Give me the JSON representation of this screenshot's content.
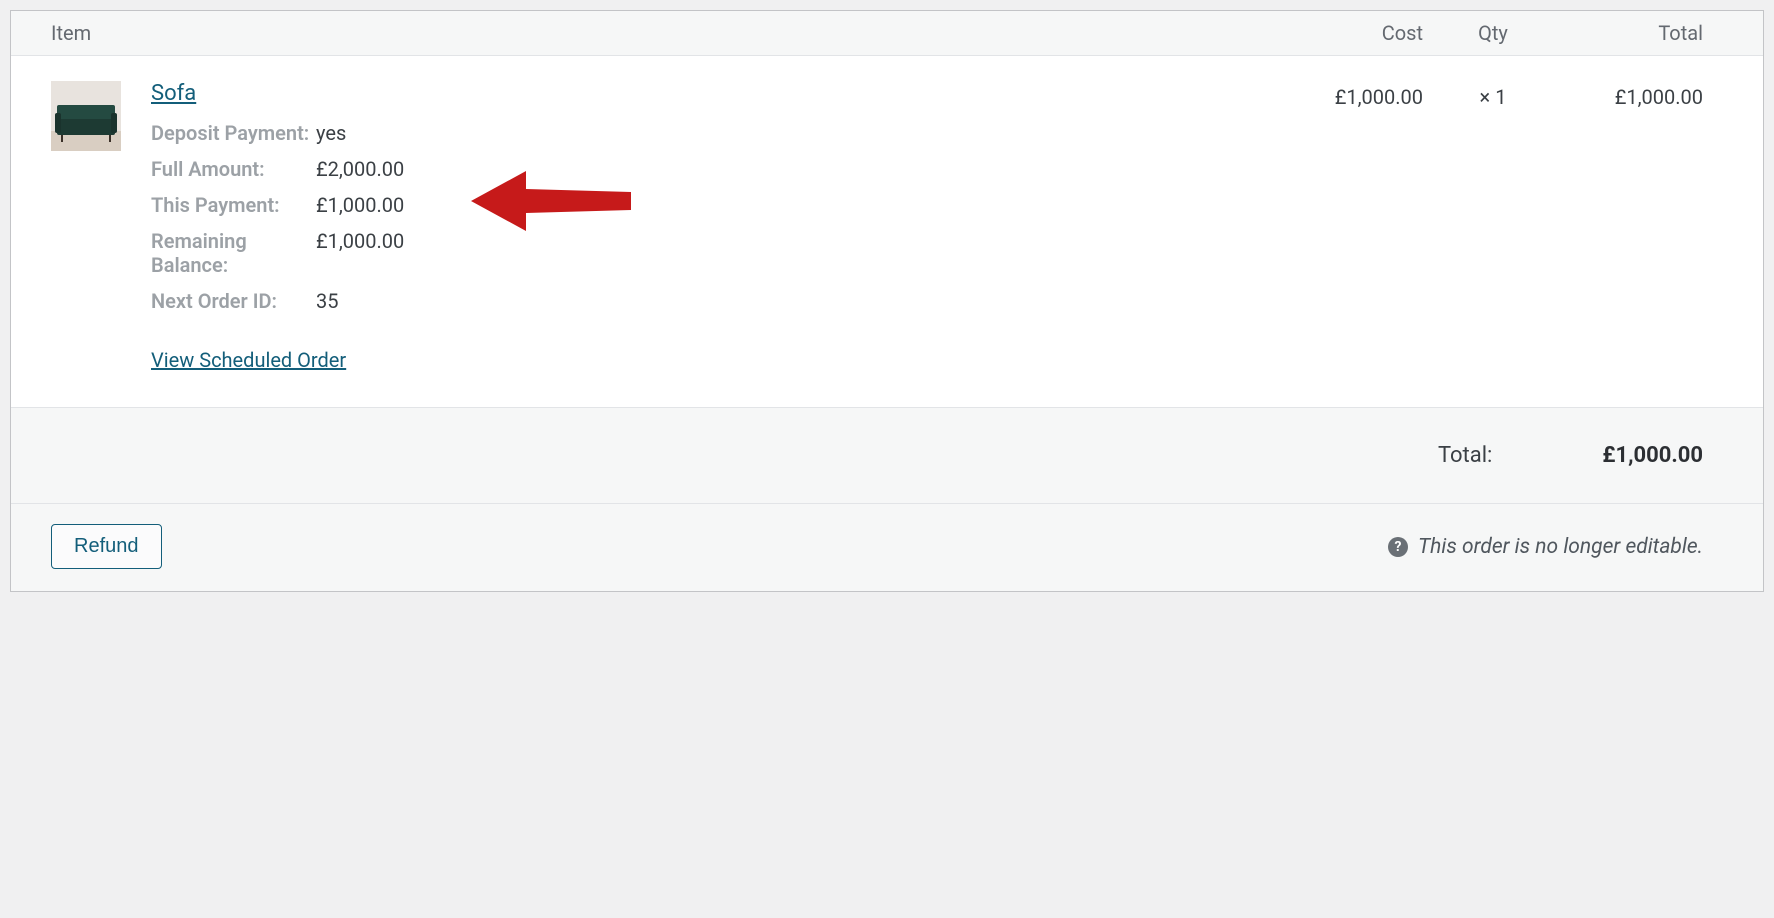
{
  "table_header": {
    "item": "Item",
    "cost": "Cost",
    "qty": "Qty",
    "total": "Total"
  },
  "item": {
    "name": "Sofa",
    "cost": "£1,000.00",
    "qty_prefix": "×",
    "qty": "1",
    "total": "£1,000.00",
    "meta": {
      "deposit_payment_label": "Deposit Payment:",
      "deposit_payment_value": "yes",
      "full_amount_label": "Full Amount:",
      "full_amount_value": "£2,000.00",
      "this_payment_label": "This Payment:",
      "this_payment_value": "£1,000.00",
      "remaining_label": "Remaining Balance:",
      "remaining_value": "£1,000.00",
      "next_order_label": "Next Order ID:",
      "next_order_value": "35"
    },
    "scheduled_link": "View Scheduled Order"
  },
  "totals": {
    "label": "Total:",
    "value": "£1,000.00"
  },
  "footer": {
    "refund": "Refund",
    "notice": "This order is no longer editable."
  }
}
